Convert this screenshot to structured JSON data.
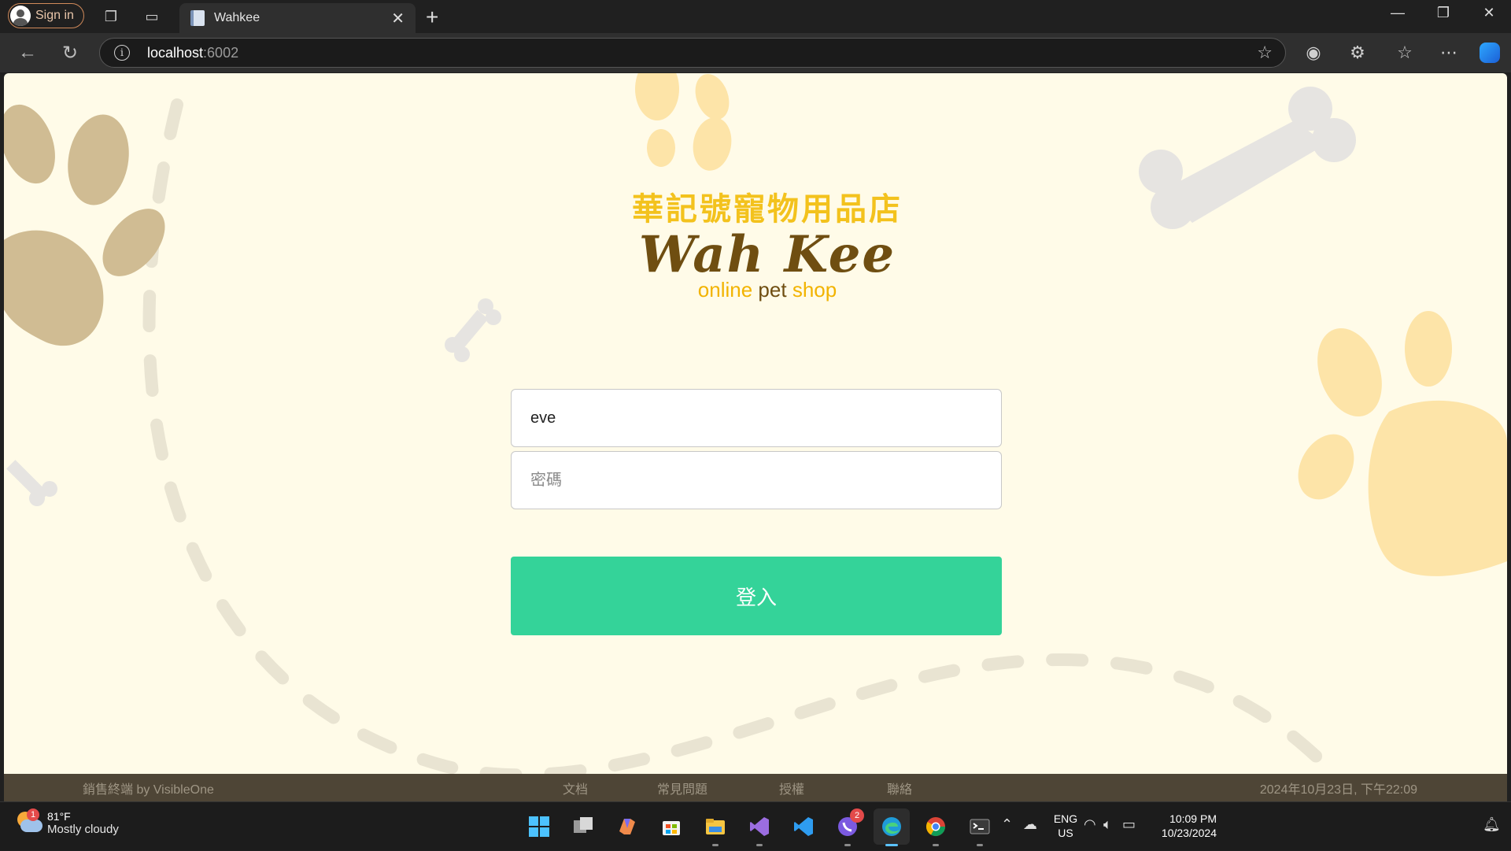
{
  "browser": {
    "signin_label": "Sign in",
    "tab_title": "Wahkee",
    "url_host": "localhost",
    "url_port": ":6002"
  },
  "logo": {
    "chinese_name": "華記號寵物用品店",
    "english_name": "Wah Kee",
    "subtitle_online": "online",
    "subtitle_pet": "pet",
    "subtitle_shop": "shop"
  },
  "login_form": {
    "username_value": "eve",
    "password_placeholder": "密碼",
    "submit_label": "登入"
  },
  "footer": {
    "brand": "銷售終端 by VisibleOne",
    "links": [
      "文档",
      "常見問題",
      "授權",
      "聯絡"
    ],
    "datetime": "2024年10月23日, 下午22:09"
  },
  "taskbar": {
    "weather_temp": "81°F",
    "weather_condition": "Mostly cloudy",
    "weather_badge": "1",
    "viber_badge": "2",
    "lang_line1": "ENG",
    "lang_line2": "US",
    "time": "10:09 PM",
    "date": "10/23/2024"
  },
  "colors": {
    "page_background": "#fffbe8",
    "login_button": "#34d399",
    "logo_yellow": "#f3c21d",
    "logo_brown": "#6f4e11",
    "footer_background": "#4e4536"
  }
}
